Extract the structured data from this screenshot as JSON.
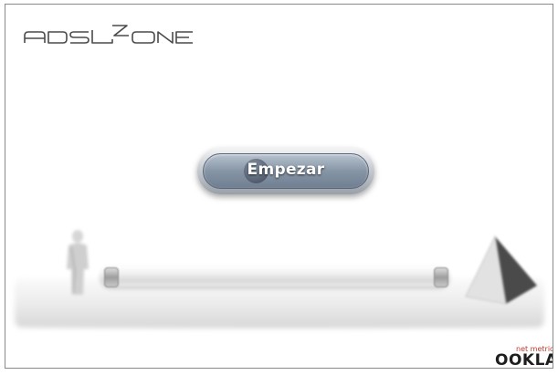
{
  "brand": {
    "logo_text": "ADSLZONE"
  },
  "start_button": {
    "label": "Empezar"
  },
  "footer": {
    "ookla_tag": "net metrics",
    "ookla_name": "OOKLA"
  },
  "colors": {
    "button_blue": "#8695a6",
    "frame_border": "#8a8a8a",
    "ookla_red": "#c0392b"
  },
  "icons": {
    "person": "person-figure-icon",
    "pyramid": "pyramid-icon",
    "ookla": "ookla-logo-icon"
  }
}
